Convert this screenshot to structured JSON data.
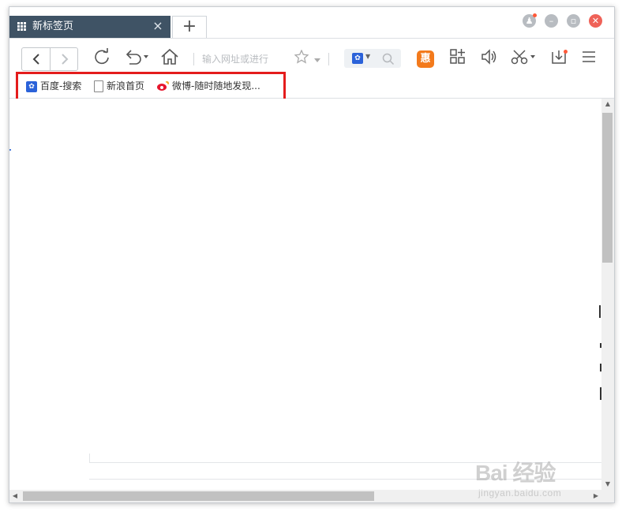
{
  "tabs": [
    {
      "title": "新标签页",
      "active": true
    }
  ],
  "newtab": {
    "label": "+"
  },
  "window_controls": {
    "min": "–",
    "max": "▫",
    "close": "✕"
  },
  "toolbar": {
    "back_icon": "‹",
    "forward_icon": "›",
    "address_placeholder": "输入网址或进行",
    "search_engine": "baidu-paw-icon",
    "hui_label": "惠"
  },
  "bookmarks": [
    {
      "label": "百度-搜索",
      "icon": "baidu-paw-icon"
    },
    {
      "label": "新浪首页",
      "icon": "page-icon"
    },
    {
      "label": "微博-随时随地发现...",
      "icon": "weibo-icon"
    }
  ],
  "colors": {
    "tab_active": "#3f5365",
    "highlight_frame": "#e41c1c",
    "close_button": "#ef6258",
    "accent_orange": "#f37a1c"
  },
  "watermark": {
    "main": "Bai 经验",
    "sub": "jingyan.baidu.com"
  }
}
